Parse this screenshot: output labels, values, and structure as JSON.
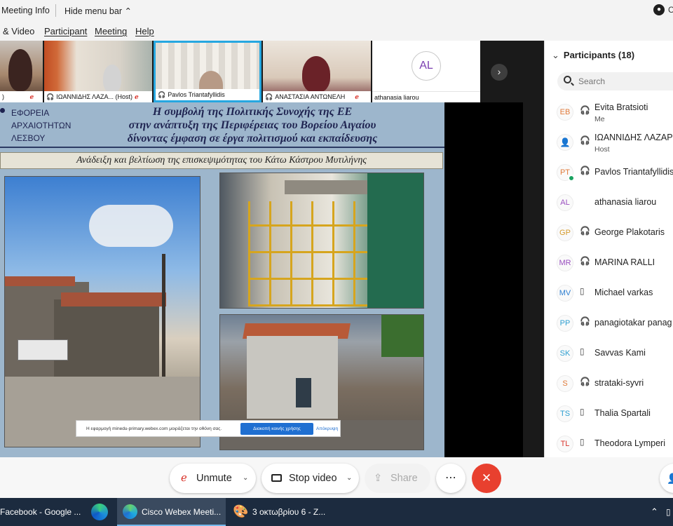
{
  "topbar": {
    "meeting_info": "Meeting Info",
    "hide_menu": "Hide menu bar ⌃",
    "cut_glyph": "C"
  },
  "menubar": {
    "audio_video": "& Video",
    "participant": "Participant",
    "meeting": "Meeting",
    "help": "Help"
  },
  "thumbnails": [
    {
      "label": ")"
    },
    {
      "label": "ΙΩΑΝΝΙΔΗΣ ΛΑΖΑ... (Host)"
    },
    {
      "label": "Pavlos Triantafyllidis"
    },
    {
      "label": "ΑΝΑΣΤΑΣΙΑ ΑΝΤΩΝΕΛΗ"
    },
    {
      "label": "athanasia liarou",
      "initials": "AL"
    }
  ],
  "slide": {
    "org_lines": [
      "ΕΦΟΡΕΙΑ",
      "ΑΡΧΑΙΟΤΗΤΩΝ",
      "ΛΕΣΒΟΥ"
    ],
    "title_lines": [
      "Η συμβολή της Πολιτικής Συνοχής της ΕΕ",
      "στην ανάπτυξη της Περιφέρειας του Βορείου Αιγαίου",
      "δίνοντας έμφαση σε έργα πολιτισμού και εκπαίδευσης"
    ],
    "banner": "Ανάδειξη και βελτίωση της επισκεψιμότητας του Κάτω Κάστρου Μυτιλήνης"
  },
  "share_notice": {
    "text": "Η εφαρμογή minedu-primary.webex.com μοιράζεται την οθόνη σας.",
    "stop_label": "Διακοπή κοινής χρήσης",
    "hide_label": "Απόκρυψη"
  },
  "panel": {
    "header": "Participants (18)",
    "search_placeholder": "Search",
    "participants": [
      {
        "initials": "EB",
        "name": "Evita Bratsioti",
        "sub": "Me",
        "color": "#e07a3a",
        "icon": "headset"
      },
      {
        "initials": "",
        "name": "ΙΩΑΝΝΙΔΗΣ ΛΑΖΑΡ",
        "sub": "Host",
        "color": "#555555",
        "icon": "headset"
      },
      {
        "initials": "PT",
        "name": "Pavlos Triantafyllidis",
        "sub": "",
        "color": "#e07a3a",
        "icon": "headset"
      },
      {
        "initials": "AL",
        "name": "athanasia liarou",
        "sub": "",
        "color": "#9a4fc0",
        "icon": ""
      },
      {
        "initials": "GP",
        "name": "George Plakotaris",
        "sub": "",
        "color": "#d59a2a",
        "icon": "headset"
      },
      {
        "initials": "MR",
        "name": "MARINA RALLI",
        "sub": "",
        "color": "#9a4fc0",
        "icon": "headset"
      },
      {
        "initials": "MV",
        "name": "Michael varkas",
        "sub": "",
        "color": "#2e7fd1",
        "icon": "phone"
      },
      {
        "initials": "PP",
        "name": "panagiotakar panag",
        "sub": "",
        "color": "#2e9fd1",
        "icon": "headset"
      },
      {
        "initials": "SK",
        "name": "Savvas Kami",
        "sub": "",
        "color": "#2e9fd1",
        "icon": "phone"
      },
      {
        "initials": "S",
        "name": "strataki-syvri",
        "sub": "",
        "color": "#e07a3a",
        "icon": "headset"
      },
      {
        "initials": "TS",
        "name": "Thalia Spartali",
        "sub": "",
        "color": "#2e9fd1",
        "icon": "phone"
      },
      {
        "initials": "TL",
        "name": "Theodora Lymperi",
        "sub": "",
        "color": "#d9342b",
        "icon": "phone"
      }
    ]
  },
  "controls": {
    "unmute": "Unmute",
    "stop_video": "Stop video",
    "share": "Share",
    "more": "⋯",
    "leave": "✕"
  },
  "taskbar": {
    "facebook": "Facebook - Google ...",
    "webex": "Cisco Webex Meeti...",
    "paint": "3 οκτωβρίου 6 - Z...",
    "up_glyph": "⌃"
  }
}
